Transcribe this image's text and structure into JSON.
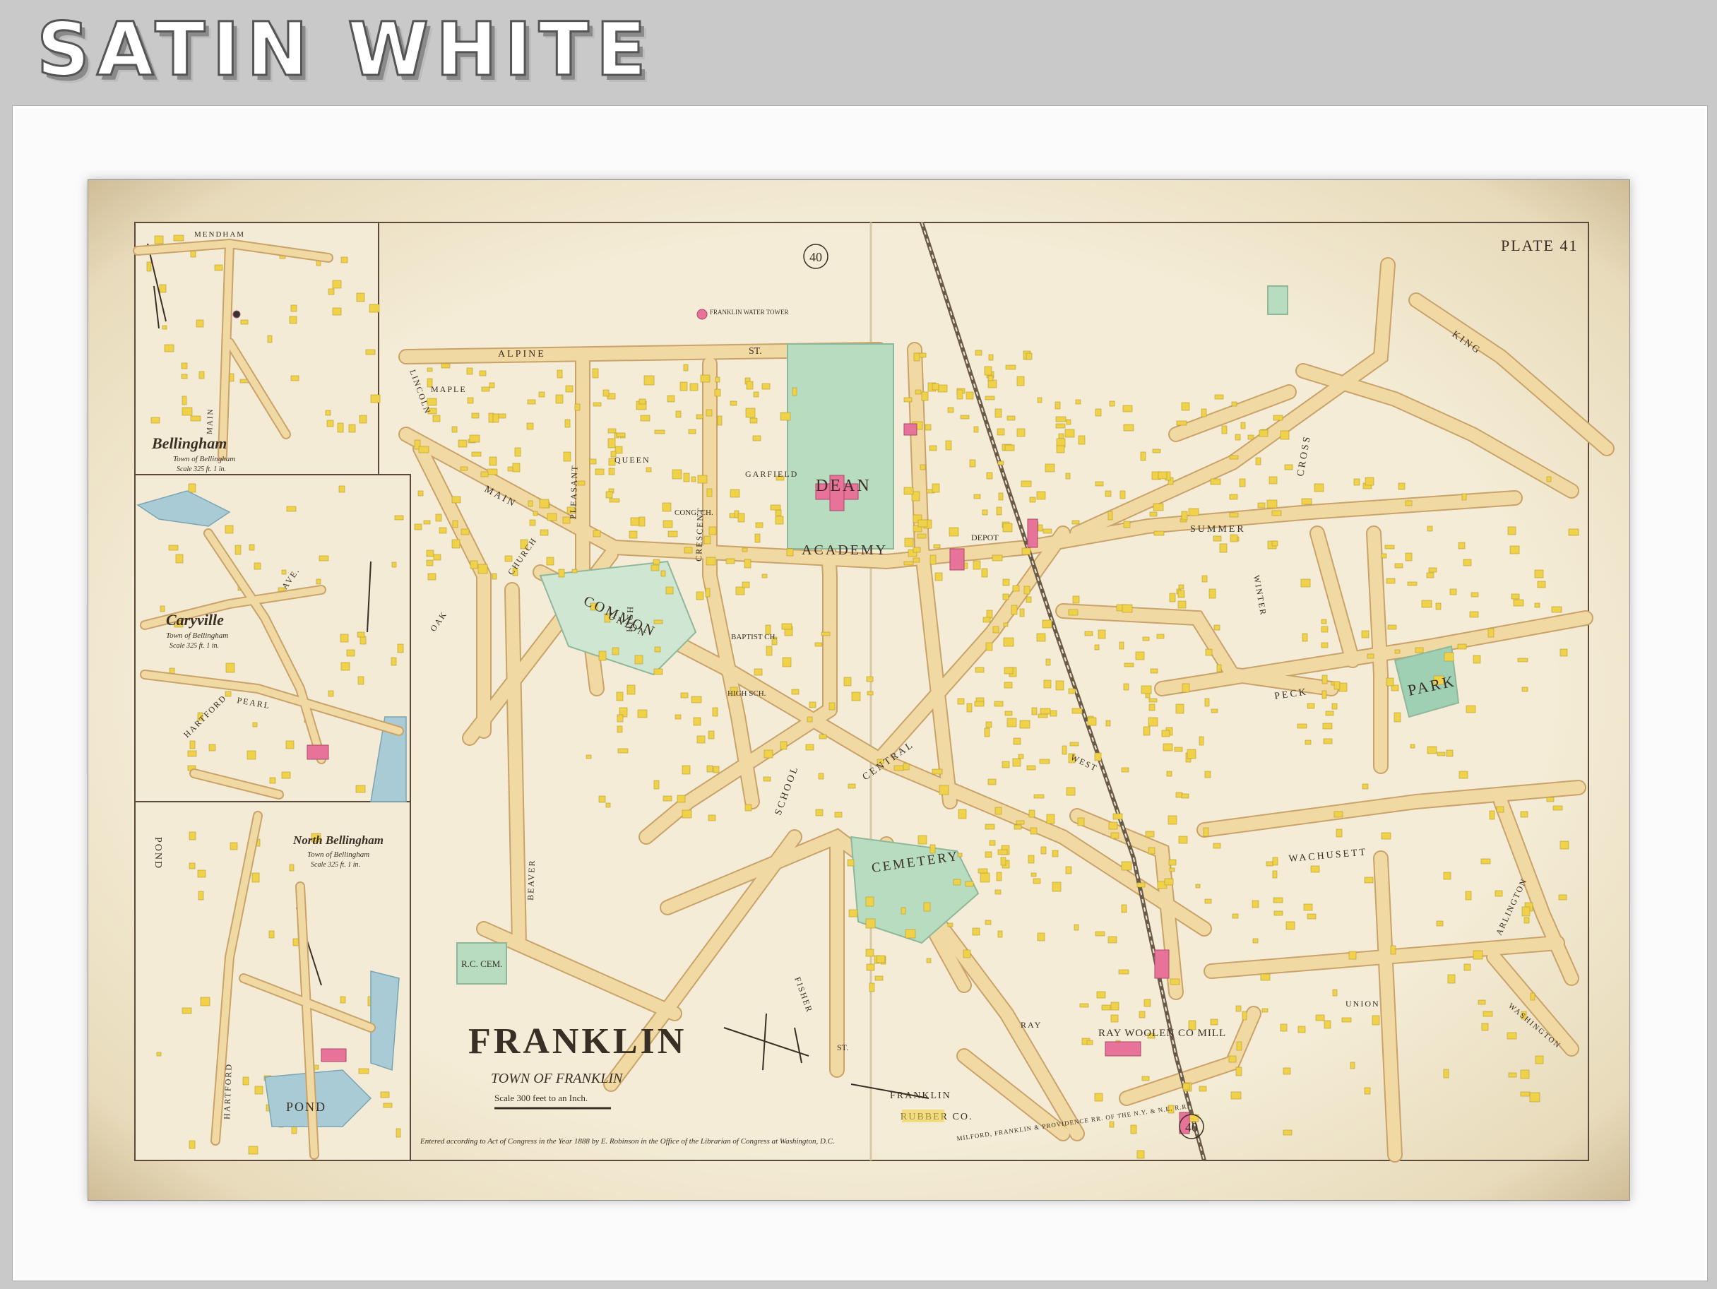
{
  "banner": {
    "title": "SATIN WHITE"
  },
  "map": {
    "plate": "PLATE 41",
    "page_ref_top": "40",
    "page_ref_bottom": "40",
    "main": {
      "title": "FRANKLIN",
      "subtitle": "TOWN OF FRANKLIN",
      "scale": "Scale 300 feet to an Inch.",
      "copyright": "Entered according to Act of Congress in the Year 1888 by E. Robinson in the Office of the Librarian of Congress at Washington, D.C."
    },
    "insets": [
      {
        "title": "Bellingham",
        "town": "Town of Bellingham",
        "scale": "Scale 325 ft. 1 in."
      },
      {
        "title": "Caryville",
        "town": "Town of Bellingham",
        "scale": "Scale 325 ft. 1 in."
      },
      {
        "title": "North Bellingham",
        "town": "Town of Bellingham",
        "scale": "Scale 325 ft. 1 in."
      }
    ],
    "landmarks": {
      "dean_academy_1": "DEAN",
      "dean_academy_2": "ACADEMY",
      "common": "COMMON",
      "cemetery": "CEMETERY",
      "park": "PARK",
      "rc_cem": "R.C. CEM.",
      "water_tower": "FRANKLIN WATER TOWER",
      "ray_woolen_mill": "RAY WOOLEN CO MILL",
      "franklin_rubber_1": "FRANKLIN",
      "franklin_rubber_2": "RUBBER CO.",
      "depot": "DEPOT",
      "pond_1": "POND",
      "pond_2": "POND",
      "high_sch": "HIGH SCH.",
      "baptist_ch": "BAPTIST CH.",
      "cong_ch": "CONG. CH."
    },
    "streets": {
      "alpine": "ALPINE",
      "alpine_st": "ST.",
      "main": "MAIN",
      "union": "UNION",
      "union_e": "UNION",
      "central": "CENTRAL",
      "school": "SCHOOL",
      "summer": "SUMMER",
      "peck": "PECK",
      "wachusett": "WACHUSETT",
      "king": "KING",
      "cross": "CROSS",
      "pleasant": "PLEASANT",
      "high": "HIGH",
      "crescent": "CRESCENT",
      "queen": "QUEEN",
      "garfield": "GARFIELD",
      "lincoln": "LINCOLN",
      "maple": "MAPLE",
      "oak": "OAK",
      "church": "CHURCH",
      "beaver": "BEAVER",
      "fisher": "FISHER",
      "west": "WEST",
      "winter": "WINTER",
      "arlington": "ARLINGTON",
      "washington": "WASHINGTON",
      "ray": "RAY",
      "st": "ST."
    },
    "railroad": "MILFORD, FRANKLIN & PROVIDENCE RR. OF THE N.Y. & N.E. R.R.",
    "inset_streets": {
      "mendham": "MENDHAM",
      "main_b": "MAIN",
      "pearl": "PEARL",
      "hartford": "HARTFORD",
      "hartford_n": "HARTFORD",
      "ave": "AVE."
    }
  },
  "colors": {
    "paper": "#f2ead3",
    "road": "#f1d9a4",
    "road_edge": "#c9a36a",
    "park_green": "#b8dcc0",
    "building_yellow": "#f0d24a",
    "building_pink": "#e8739a",
    "water_blue": "#a9cbd6"
  }
}
